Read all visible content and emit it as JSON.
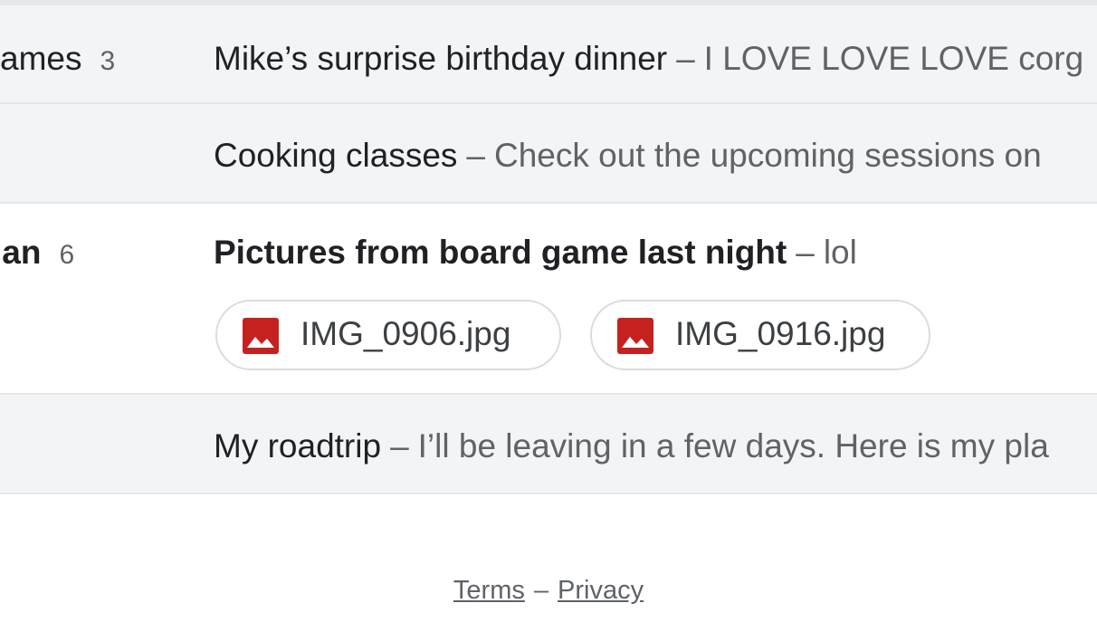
{
  "threads": [
    {
      "sender": "ames",
      "count": "3",
      "subject": "Mike’s surprise birthday dinner",
      "separator": "–",
      "snippet": "I LOVE LOVE LOVE corg",
      "unread": false
    },
    {
      "sender": "",
      "count": "",
      "subject": "Cooking classes",
      "separator": "–",
      "snippet": "Check out the upcoming sessions on",
      "unread": false
    },
    {
      "sender": "lan",
      "count": "6",
      "subject": "Pictures from board game last night",
      "separator": "–",
      "snippet": "lol",
      "unread": true,
      "attachments": [
        {
          "name": "IMG_0906.jpg",
          "icon": "image-file-icon"
        },
        {
          "name": "IMG_0916.jpg",
          "icon": "image-file-icon"
        }
      ]
    },
    {
      "sender": "",
      "count": "",
      "subject": "My roadtrip",
      "separator": "–",
      "snippet": "I’ll be leaving in a few days. Here is my pla",
      "unread": false
    }
  ],
  "footer": {
    "terms": "Terms",
    "separator": "–",
    "privacy": "Privacy"
  },
  "colors": {
    "read_row_bg": "#f2f4f5",
    "unread_row_bg": "#ffffff",
    "image_icon_red": "#c5221f",
    "text_primary": "#202124",
    "text_secondary": "#5f6368"
  }
}
